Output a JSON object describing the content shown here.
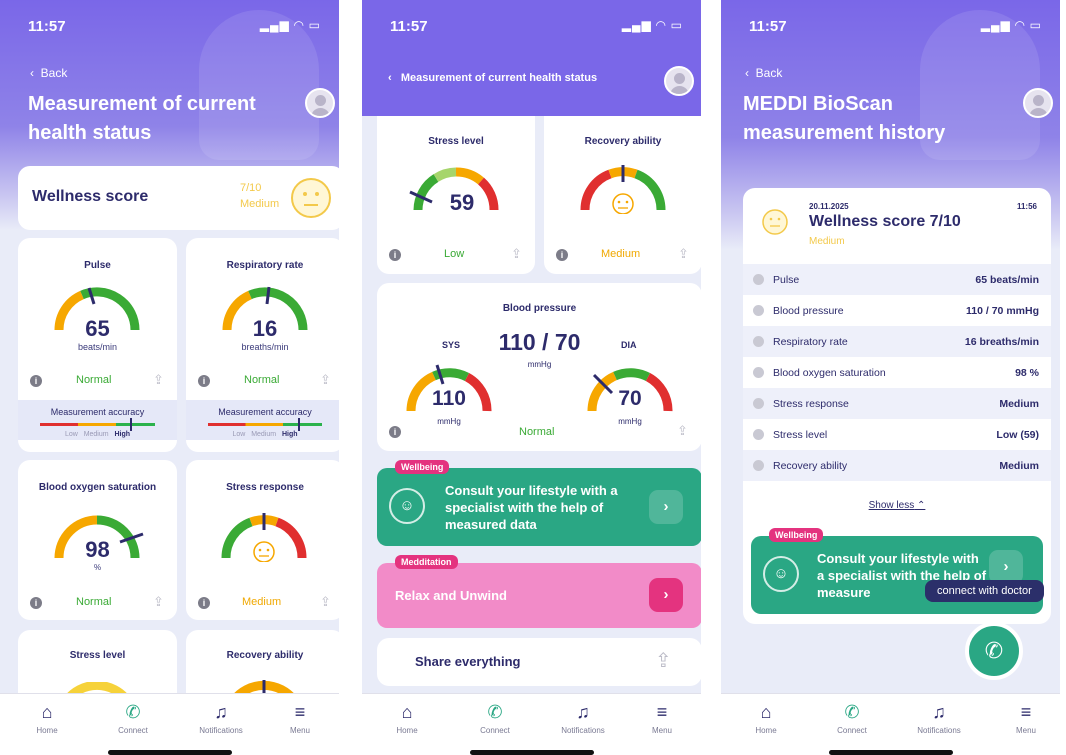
{
  "status_bar": {
    "time": "11:57"
  },
  "screen1": {
    "back_label": "Back",
    "title": "Measurement of current health status",
    "wellness": {
      "label": "Wellness score",
      "score": "7/10",
      "level": "Medium"
    },
    "cards": [
      {
        "title": "Pulse",
        "value": "65",
        "unit": "beats/min",
        "status": "Normal",
        "accuracy_label": "Measurement accuracy",
        "accuracy_levels": [
          "Low",
          "Medium",
          "High"
        ]
      },
      {
        "title": "Respiratory rate",
        "value": "16",
        "unit": "breaths/min",
        "status": "Normal",
        "accuracy_label": "Measurement accuracy",
        "accuracy_levels": [
          "Low",
          "Medium",
          "High"
        ]
      },
      {
        "title": "Blood oxygen saturation",
        "value": "98",
        "unit": "%",
        "status": "Normal"
      },
      {
        "title": "Stress response",
        "status": "Medium"
      },
      {
        "title": "Stress level"
      },
      {
        "title": "Recovery ability"
      }
    ]
  },
  "screen2": {
    "title": "Measurement of current health status",
    "stress_level": {
      "title": "Stress level",
      "value": "59",
      "status": "Low"
    },
    "recovery": {
      "title": "Recovery ability",
      "status": "Medium"
    },
    "blood_pressure": {
      "title": "Blood pressure",
      "value": "110 / 70",
      "unit": "mmHg",
      "sys_label": "SYS",
      "dia_label": "DIA",
      "sys": "110",
      "dia": "70",
      "sys_unit": "mmHg",
      "dia_unit": "mmHg",
      "status": "Normal"
    },
    "promo_wellbeing": {
      "tag": "Wellbeing",
      "text": "Consult your lifestyle with a specialist with the help of measured data"
    },
    "promo_meditation": {
      "tag": "Medditation",
      "text": "Relax and Unwind"
    },
    "share_label": "Share everything"
  },
  "screen3": {
    "back_label": "Back",
    "title": "MEDDI BioScan measurement history",
    "entry": {
      "date": "20.11.2025",
      "time": "11:56",
      "title": "Wellness score 7/10",
      "level": "Medium"
    },
    "rows": [
      {
        "label": "Pulse",
        "value": "65 beats/min"
      },
      {
        "label": "Blood pressure",
        "value": "110 / 70 mmHg"
      },
      {
        "label": "Respiratory rate",
        "value": "16 breaths/min"
      },
      {
        "label": "Blood oxygen saturation",
        "value": "98 %"
      },
      {
        "label": "Stress response",
        "value": "Medium"
      },
      {
        "label": "Stress level",
        "value": "Low (59)"
      },
      {
        "label": "Recovery ability",
        "value": "Medium"
      }
    ],
    "show_less": "Show less",
    "promo": {
      "tag": "Wellbeing",
      "text": "Consult your lifestyle with a specialist with the help of measure"
    },
    "tooltip": "connect with doctor"
  },
  "nav": [
    {
      "label": "Home",
      "icon": "home-icon"
    },
    {
      "label": "Connect",
      "icon": "phone-icon"
    },
    {
      "label": "Notifications",
      "icon": "bell-icon"
    },
    {
      "label": "Menu",
      "icon": "menu-icon"
    }
  ],
  "colors": {
    "primary": "#7a67e8",
    "navy": "#2d2b6b",
    "green": "#3aaa35",
    "orange": "#f0a800",
    "teal": "#2aa784",
    "pink": "#f28bc8"
  }
}
